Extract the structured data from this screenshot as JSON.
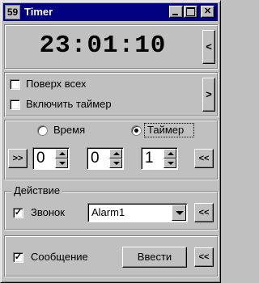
{
  "window": {
    "icon_text": "59",
    "title": "Timer"
  },
  "clock": {
    "time": "23:01:10",
    "collapse_label": "<"
  },
  "options": {
    "on_top": {
      "label": "Поверх всех",
      "checked": false
    },
    "enable_timer": {
      "label": "Включить таймер",
      "checked": false
    },
    "expand_label": ">"
  },
  "mode": {
    "time_label": "Время",
    "timer_label": "Таймер",
    "selected": "timer",
    "apply_label": ">>",
    "reset_label": "<<",
    "hours": "0",
    "minutes": "0",
    "seconds": "1"
  },
  "action": {
    "group_label": "Действие",
    "bell": {
      "label": "Звонок",
      "checked": true,
      "check_mark": "✓"
    },
    "sound_select": {
      "value": "Alarm1"
    },
    "sound_button_label": "<<",
    "message": {
      "label": "Сообщение",
      "checked": true,
      "check_mark": "✓"
    },
    "enter_button_label": "Ввести",
    "message_button_label": "<<"
  }
}
